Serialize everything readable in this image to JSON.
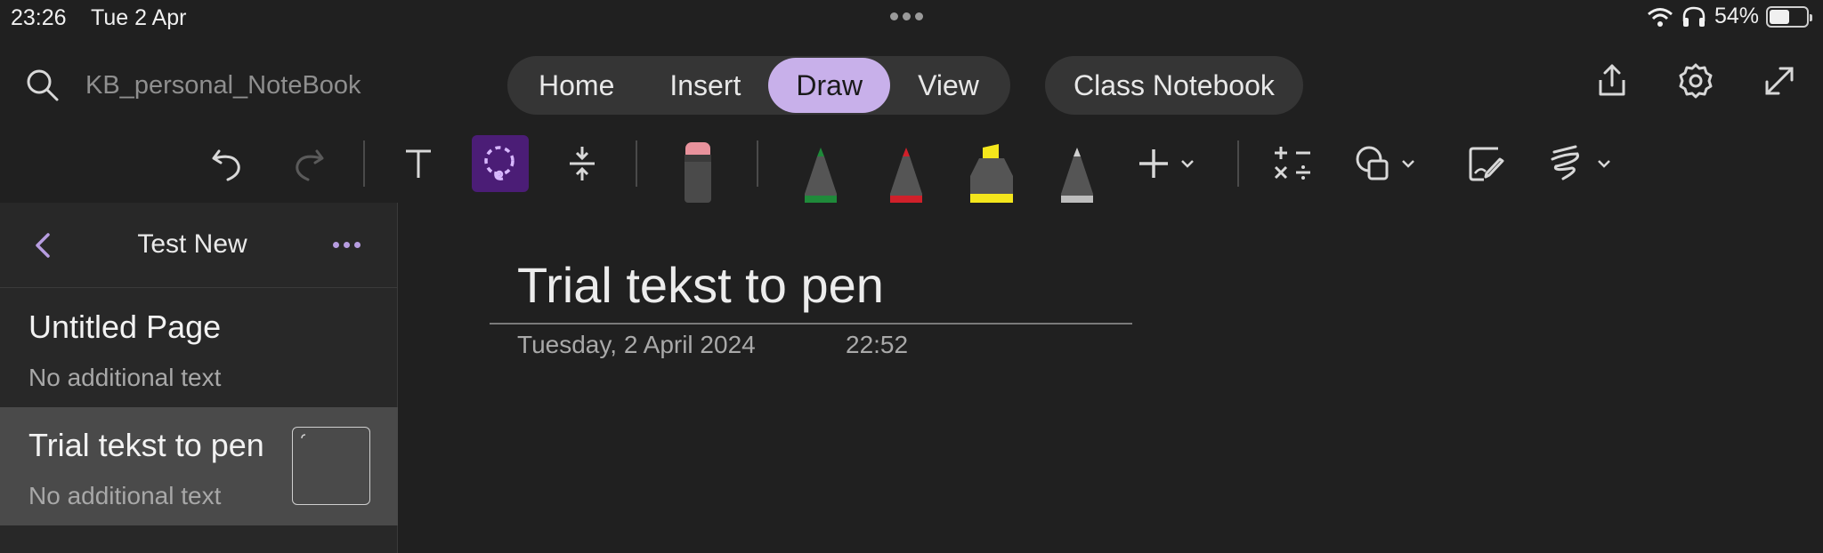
{
  "status_bar": {
    "time": "23:26",
    "date": "Tue 2 Apr",
    "battery_percent": "54%",
    "battery_level": 0.54,
    "icons": [
      "wifi-icon",
      "headphones-icon",
      "battery-icon"
    ]
  },
  "top_bar": {
    "notebook_name": "KB_personal_NoteBook",
    "tabs": [
      {
        "label": "Home",
        "active": false
      },
      {
        "label": "Insert",
        "active": false
      },
      {
        "label": "Draw",
        "active": true
      },
      {
        "label": "View",
        "active": false
      }
    ],
    "class_notebook_label": "Class Notebook",
    "icons": [
      "search-icon",
      "share-icon",
      "settings-icon",
      "fullscreen-icon"
    ]
  },
  "draw_toolbar": {
    "tools": [
      "undo-icon",
      "redo-icon",
      "type-text-icon",
      "lasso-select-icon",
      "insert-space-icon",
      "eraser-icon",
      "green-pen-icon",
      "red-pen-icon",
      "yellow-highlighter-icon",
      "gray-pencil-icon",
      "add-pen-icon",
      "math-icon",
      "shapes-icon",
      "ink-to-text-icon",
      "ink-to-shape-icon"
    ],
    "selected_tool": "lasso-select-icon",
    "pen_colors": {
      "green": "#1f8a3a",
      "red": "#d0202a",
      "yellow": "#f4e61c",
      "gray": "#bdbdbd"
    },
    "accent_color": "#c8b0ea"
  },
  "sidebar": {
    "section_title": "Test New",
    "pages": [
      {
        "title": "Untitled Page",
        "subtitle": "No additional text",
        "selected": false
      },
      {
        "title": "Trial tekst to pen",
        "subtitle": "No additional text",
        "selected": true
      }
    ]
  },
  "note": {
    "title": "Trial tekst to pen",
    "date": "Tuesday, 2 April 2024",
    "time": "22:52"
  }
}
